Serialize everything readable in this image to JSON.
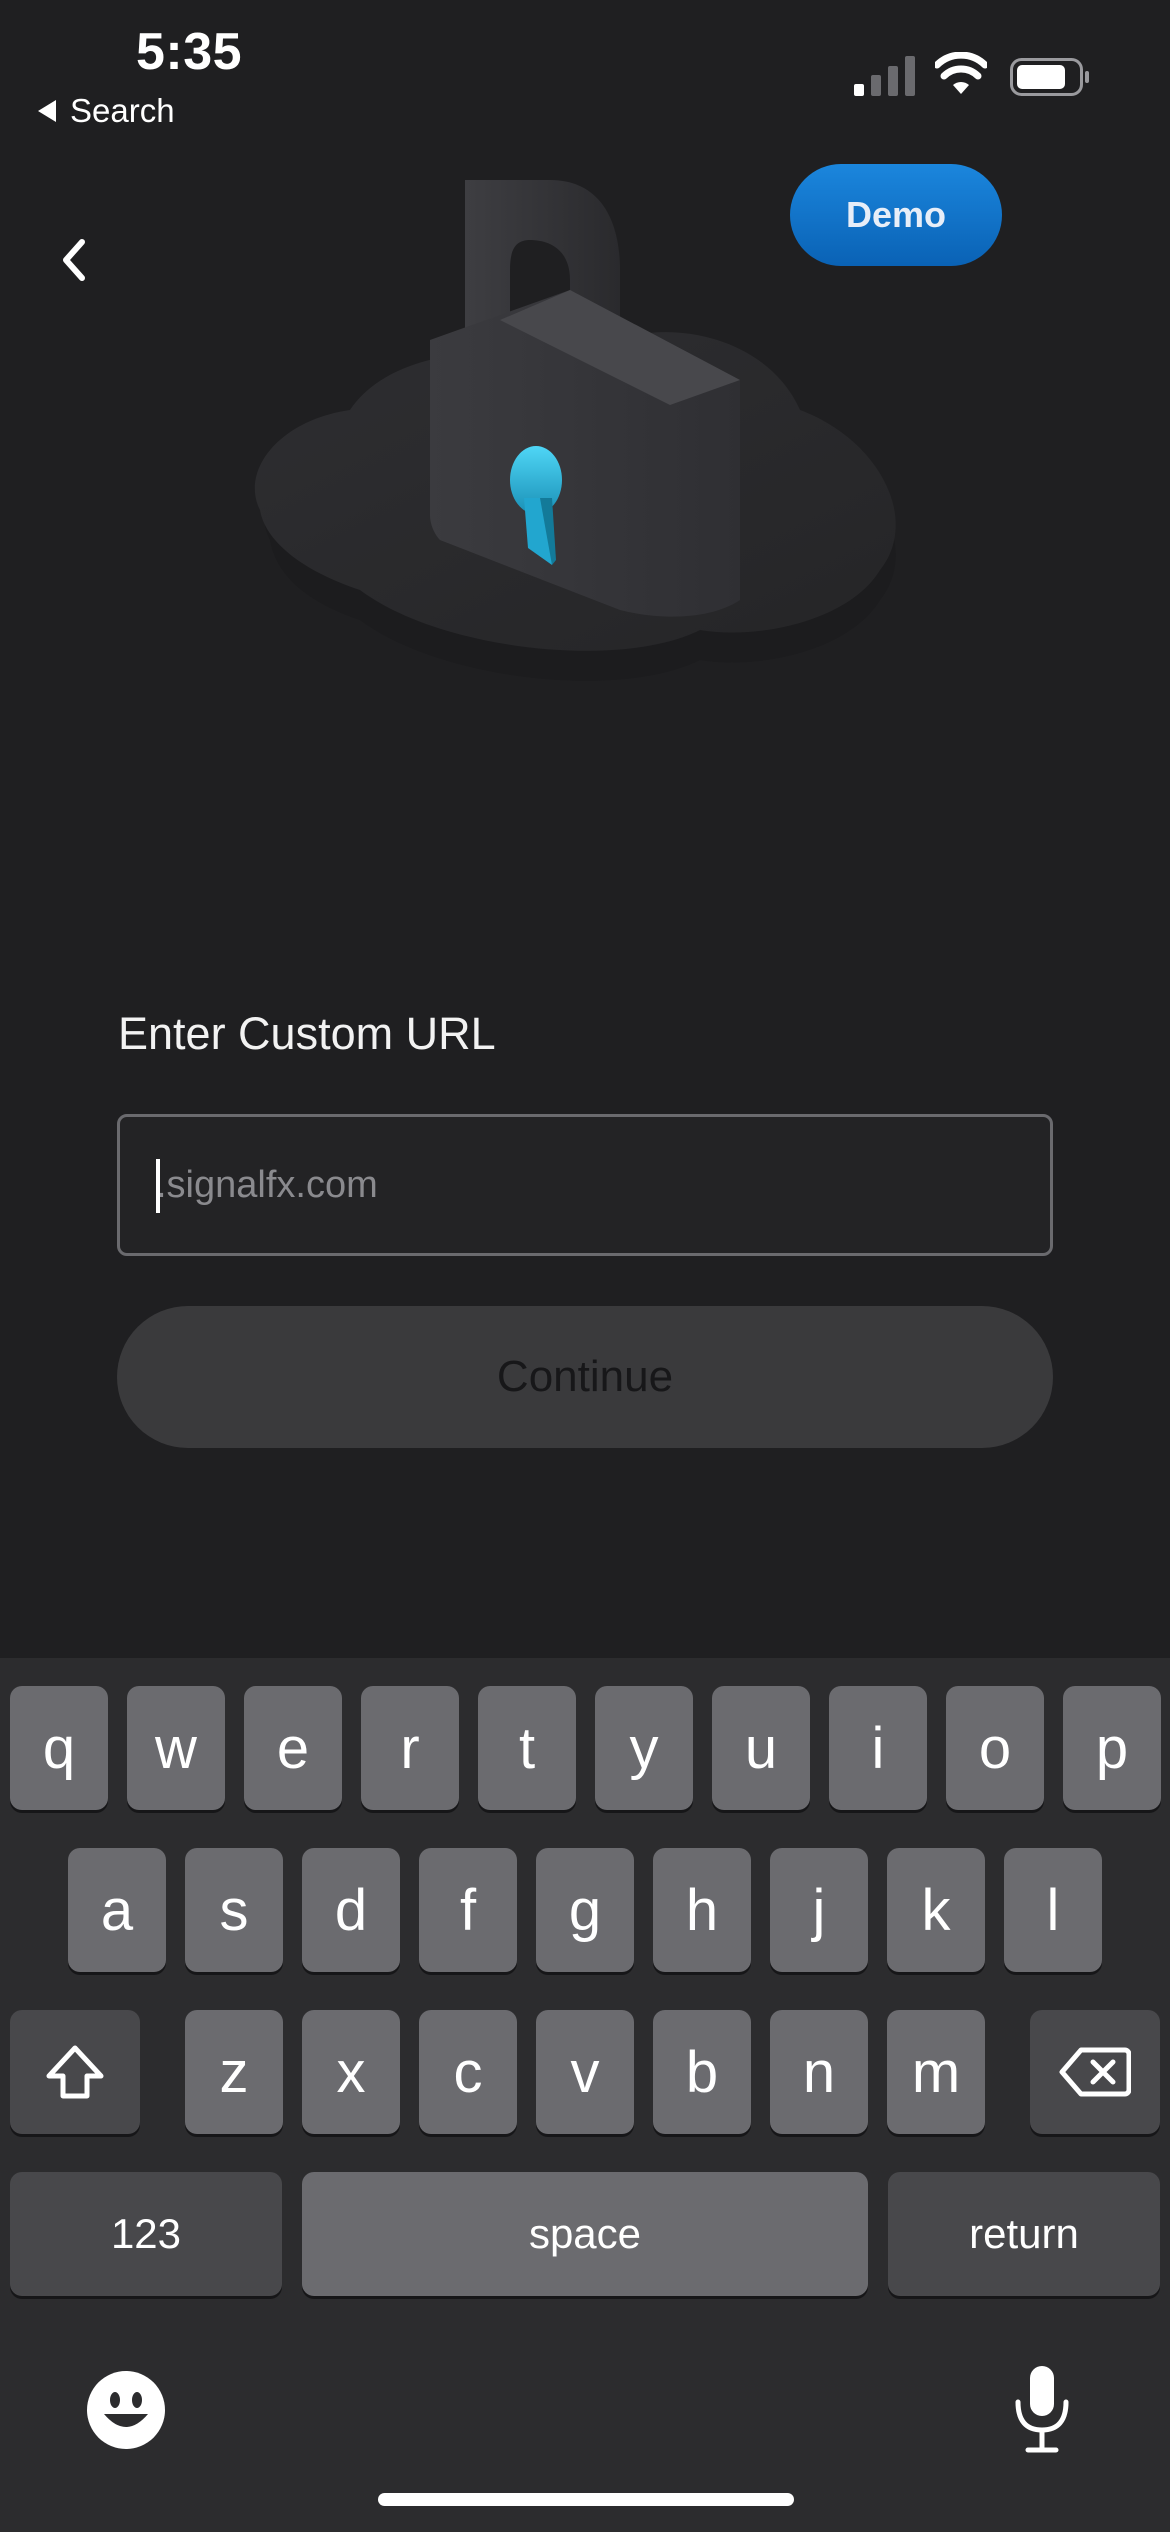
{
  "status_bar": {
    "time": "5:35",
    "back_app_label": "Search",
    "signal_icon": "cellular-signal-icon",
    "wifi_icon": "wifi-icon",
    "battery_icon": "battery-icon"
  },
  "nav": {
    "back_icon": "chevron-left-icon",
    "demo_label": "Demo"
  },
  "illustration": {
    "icon": "padlock-cloud-illustration",
    "accent": "#3fc7f0"
  },
  "form": {
    "title": "Enter Custom URL",
    "url_placeholder": ".signalfx.com",
    "url_value": "",
    "continue_label": "Continue"
  },
  "keyboard": {
    "row1": [
      "q",
      "w",
      "e",
      "r",
      "t",
      "y",
      "u",
      "i",
      "o",
      "p"
    ],
    "row2": [
      "a",
      "s",
      "d",
      "f",
      "g",
      "h",
      "j",
      "k",
      "l"
    ],
    "row3": [
      "z",
      "x",
      "c",
      "v",
      "b",
      "n",
      "m"
    ],
    "shift_icon": "shift-icon",
    "delete_icon": "backspace-icon",
    "numbers_label": "123",
    "space_label": "space",
    "return_label": "return",
    "emoji_icon": "emoji-icon",
    "mic_icon": "microphone-icon"
  },
  "colors": {
    "background": "#1f1f21",
    "accent": "#0a6fc9",
    "keyboard_bg": "#2c2c2e"
  }
}
